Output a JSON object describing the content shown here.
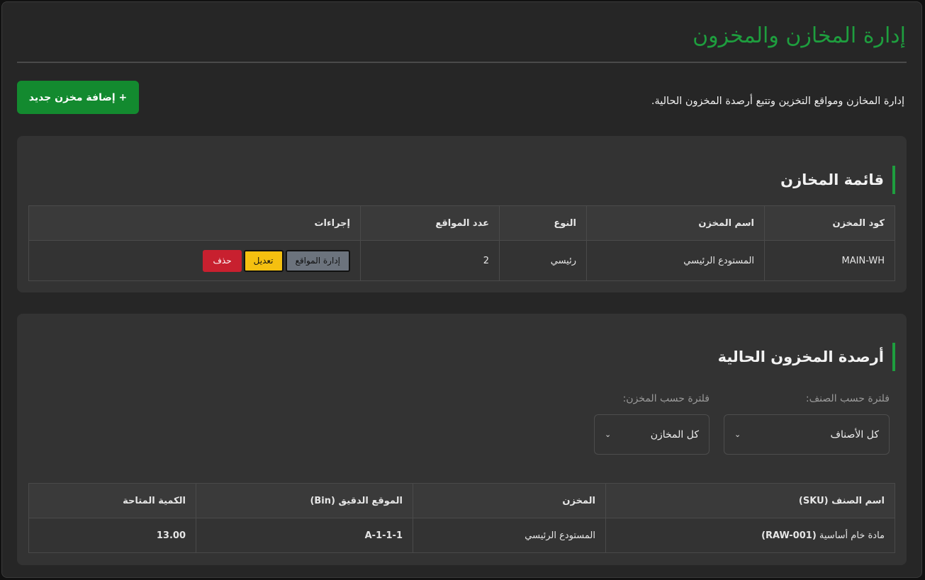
{
  "header": {
    "title": "إدارة المخازن والمخزون",
    "intro": "إدارة المخازن ومواقع التخزين وتتبع أرصدة المخزون الحالية.",
    "add_button": "+ إضافة مخزن جديد"
  },
  "warehouses": {
    "title": "قائمة المخازن",
    "columns": [
      "كود المخزن",
      "اسم المخزن",
      "النوع",
      "عدد المواقع",
      "إجراءات"
    ],
    "rows": [
      {
        "code": "MAIN-WH",
        "name": "المستودع الرئيسي",
        "type": "رئيسي",
        "bins": "2"
      }
    ],
    "actions": {
      "bins": "إدارة المواقع",
      "edit": "تعديل",
      "delete": "حذف"
    }
  },
  "balances": {
    "title": "أرصدة المخزون الحالية",
    "filter_item_label": "فلترة حسب الصنف:",
    "filter_item_value": "كل الأصناف",
    "filter_wh_label": "فلترة حسب المخزن:",
    "filter_wh_value": "كل المخازن",
    "columns": [
      "اسم الصنف (SKU)",
      "المخزن",
      "الموقع الدقيق (Bin)",
      "الكمية المتاحة"
    ],
    "rows": [
      {
        "item_name": "مادة خام أساسية",
        "sku": "(RAW-001)",
        "warehouse": "المستودع الرئيسي",
        "bin": "A-1-1-1",
        "qty": "13.00"
      }
    ]
  },
  "colors": {
    "accent": "#1e9e3e",
    "primary_btn": "#138a2f",
    "edit": "#f5c010",
    "delete": "#c8202f"
  },
  "icons": {
    "select_caret": "chevron-down-icon"
  }
}
